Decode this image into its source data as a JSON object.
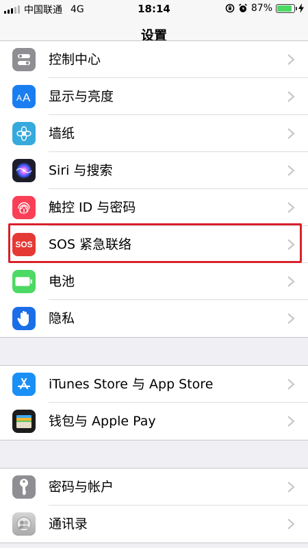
{
  "status": {
    "carrier": "中国联通",
    "network": "4G",
    "time": "18:14",
    "battery": "87%",
    "battery_level": 0.87
  },
  "nav": {
    "title": "设置"
  },
  "groups": [
    {
      "items": [
        {
          "label": "控制中心",
          "icon": "control-center-icon",
          "color": "#8e8e93"
        },
        {
          "label": "显示与亮度",
          "icon": "display-brightness-icon",
          "color": "#1b7ef0"
        },
        {
          "label": "墙纸",
          "icon": "wallpaper-icon",
          "color": "#36aadc"
        },
        {
          "label": "Siri 与搜索",
          "icon": "siri-icon",
          "color": "#222"
        },
        {
          "label": "触控 ID 与密码",
          "icon": "touch-id-icon",
          "color": "#fb3f57"
        },
        {
          "label": "SOS 紧急联络",
          "icon": "sos-icon",
          "color": "#e53935",
          "icon_text": "SOS"
        },
        {
          "label": "电池",
          "icon": "battery-icon",
          "color": "#4cd964"
        },
        {
          "label": "隐私",
          "icon": "privacy-hand-icon",
          "color": "#1a6fe8"
        }
      ]
    },
    {
      "items": [
        {
          "label": "iTunes Store 与 App Store",
          "icon": "app-store-icon",
          "color": "#1a8ff5"
        },
        {
          "label": "钱包与 Apple Pay",
          "icon": "wallet-icon",
          "color": "#1c1c1c"
        }
      ]
    },
    {
      "items": [
        {
          "label": "密码与帐户",
          "icon": "key-icon",
          "color": "#8e8e93"
        },
        {
          "label": "通讯录",
          "icon": "contacts-icon",
          "color": "#b8b8b8"
        }
      ]
    }
  ]
}
